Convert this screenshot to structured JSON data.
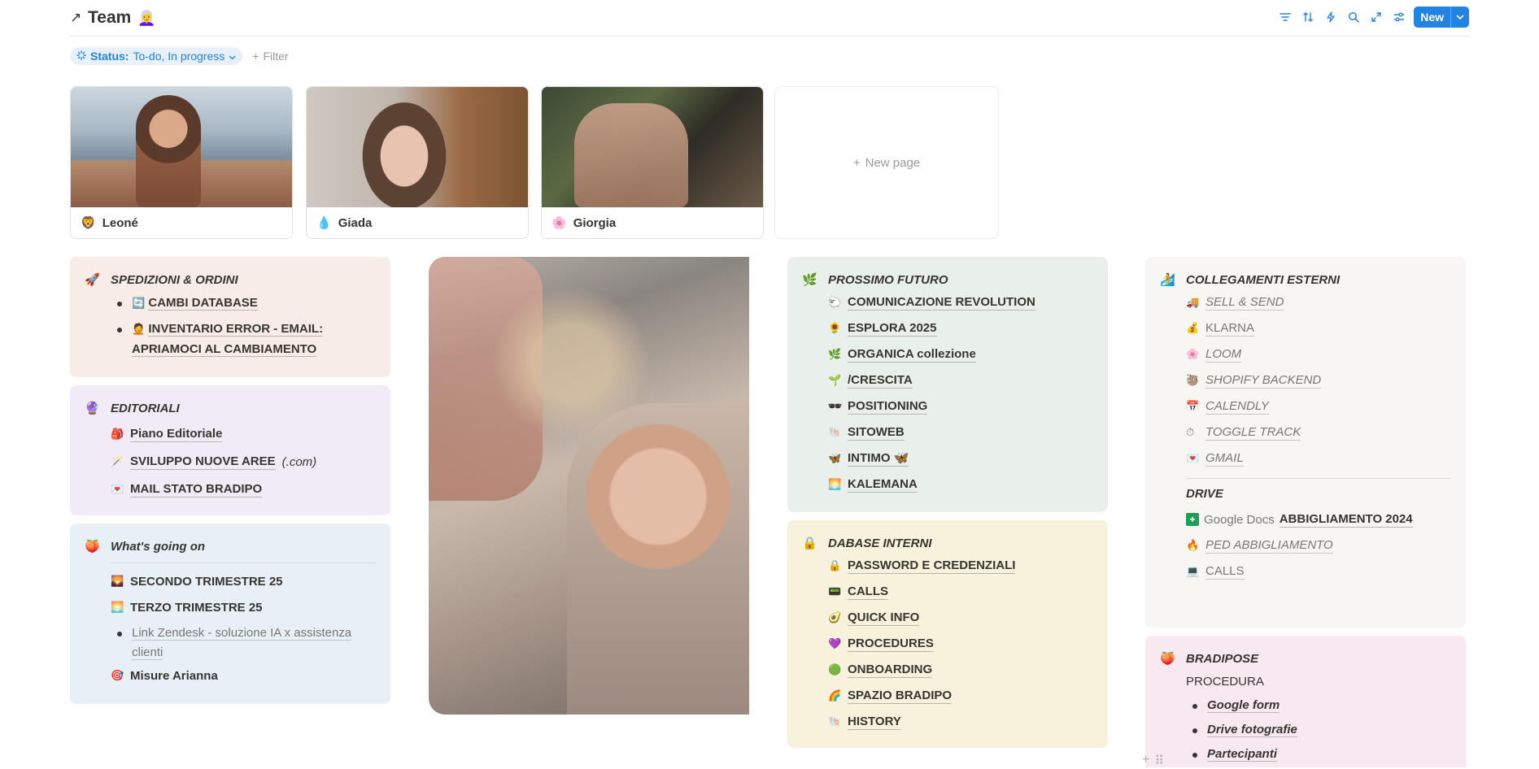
{
  "header": {
    "title": "Team",
    "title_emoji": "👩‍🦳",
    "arrow_icon": "↗",
    "new_button": "New",
    "tools": [
      "filter-icon",
      "sort-icon",
      "automation-icon",
      "search-icon",
      "expand-icon",
      "settings-icon"
    ]
  },
  "filters": {
    "status_label": "Status:",
    "status_value": "To-do, In progress",
    "add_filter": "Filter"
  },
  "gallery": {
    "cards": [
      {
        "name": "Leoné",
        "icon": "🦁"
      },
      {
        "name": "Giada",
        "icon": "💧"
      },
      {
        "name": "Giorgia",
        "icon": "🌸"
      }
    ],
    "new_page": "New page"
  },
  "spedizioni": {
    "title": "SPEDIZIONI & ORDINI",
    "icon": "🚀",
    "items": [
      {
        "icon": "🔄",
        "label": "CAMBI DATABASE"
      },
      {
        "icon": "🤦",
        "label": "INVENTARIO ERROR - EMAIL:",
        "label2": "APRIAMOCI AL CAMBIAMENTO"
      }
    ]
  },
  "editoriali": {
    "title": "EDITORIALI",
    "icon": "🔮",
    "items": [
      {
        "icon": "🎒",
        "label": "Piano Editoriale"
      },
      {
        "icon": "🪄",
        "label": "SVILUPPO NUOVE AREE",
        "suffix": "(.com)"
      },
      {
        "icon": "💌",
        "label": "MAIL STATO BRADIPO"
      }
    ]
  },
  "whats_going_on": {
    "title": "What's going on",
    "icon": "🍑",
    "items": [
      {
        "icon": "🌄",
        "label": "SECONDO TRIMESTRE 25"
      },
      {
        "icon": "🌅",
        "label": "TERZO TRIMESTRE 25"
      }
    ],
    "bullet": {
      "label": "Link Zendesk - soluzione IA x assistenza",
      "label2": "clienti"
    },
    "last": {
      "icon": "🎯",
      "label": "Misure Arianna"
    }
  },
  "prossimo_futuro": {
    "title": "PROSSIMO FUTURO",
    "icon": "🌿",
    "items": [
      {
        "icon": "🐑",
        "label": "COMUNICAZIONE REVOLUTION"
      },
      {
        "icon": "🌻",
        "label": "ESPLORA 2025"
      },
      {
        "icon": "🌿",
        "label": "ORGANICA collezione"
      },
      {
        "icon": "🌱",
        "label": "/CRESCITA"
      },
      {
        "icon": "🕶",
        "label": "POSITIONING"
      },
      {
        "icon": "🐚",
        "label": "SITOWEB"
      },
      {
        "icon": "🦋",
        "label": "INTIMO 🦋"
      },
      {
        "icon": "🌅",
        "label": "KALEMANA"
      }
    ]
  },
  "database_interni": {
    "title": "DABASE INTERNI",
    "icon": "🔒",
    "items": [
      {
        "icon": "🔒",
        "label": "PASSWORD E CREDENZIALI"
      },
      {
        "icon": "📟",
        "label": "CALLS"
      },
      {
        "icon": "🥑",
        "label": "QUICK INFO"
      },
      {
        "icon": "💜",
        "label": "PROCEDURES"
      },
      {
        "icon": "🟢",
        "label": "ONBOARDING"
      },
      {
        "icon": "🌈",
        "label": "SPAZIO BRADIPO"
      },
      {
        "icon": "🐚",
        "label": "HISTORY"
      }
    ]
  },
  "collegamenti": {
    "title": "COLLEGAMENTI ESTERNI",
    "icon": "🏄",
    "links": [
      {
        "icon": "🚚",
        "label": "SELL & SEND"
      },
      {
        "icon": "💰",
        "label": "KLARNA"
      },
      {
        "icon": "🌸",
        "label": "LOOM"
      },
      {
        "icon": "🦥",
        "label": "SHOPIFY BACKEND"
      },
      {
        "icon": "📅",
        "label": "CALENDLY"
      },
      {
        "icon": "⏱",
        "label": "TOGGLE TRACK"
      },
      {
        "icon": "💌",
        "label": "GMAIL"
      }
    ],
    "drive_title": "DRIVE",
    "drive": [
      {
        "icon": "➕",
        "prefix": "Google Docs",
        "label": "ABBIGLIAMENTO 2024"
      },
      {
        "icon": "🔥",
        "label": "PED ABBIGLIAMENTO"
      },
      {
        "icon": "💻",
        "label": "CALLS"
      }
    ]
  },
  "bradipose": {
    "title": "BRADIPOSE",
    "icon": "🍑",
    "procedura": "PROCEDURA",
    "items": [
      "Google form",
      "Drive fotografie",
      "Partecipanti"
    ]
  },
  "colors": {
    "accent": "#2383e2",
    "spedizioni_bg": "#f8ece6",
    "editoriali_bg": "#f1ebf7",
    "whats_bg": "#e8f0f7",
    "futuro_bg": "#e9efeb",
    "interni_bg": "#f8f1dc",
    "collegamenti_bg": "#f7f6f3",
    "bradipose_bg": "#f8e8ef"
  }
}
